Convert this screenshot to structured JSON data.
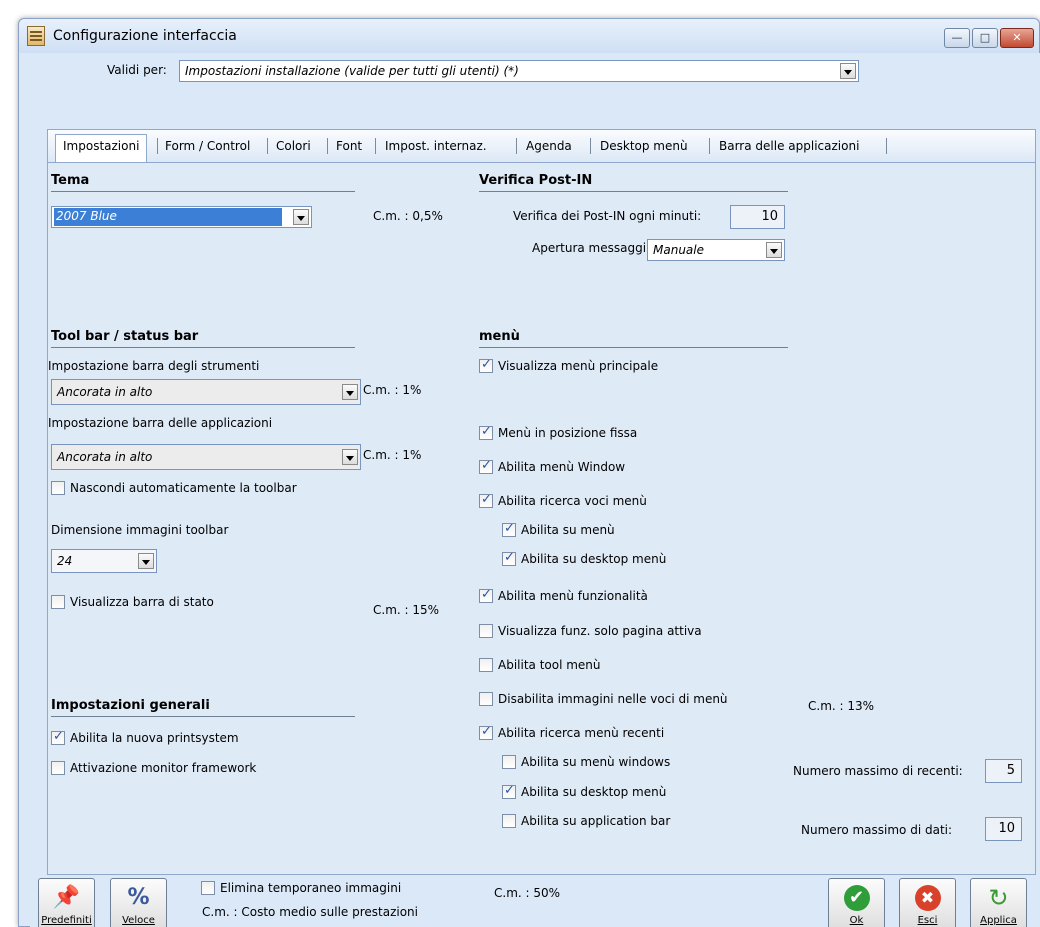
{
  "window": {
    "title": "Configurazione interfaccia"
  },
  "validi": {
    "label": "Validi per:",
    "value": "Impostazioni installazione (valide per tutti gli utenti) (*)"
  },
  "tabs": [
    "Impostazioni",
    "Form / Control",
    "Colori",
    "Font",
    "Impost. internaz.",
    "Agenda",
    "Desktop menù",
    "Barra delle applicazioni"
  ],
  "tema": {
    "header": "Tema",
    "value": "2007 Blue",
    "cm": "C.m. : 0,5%"
  },
  "postin": {
    "header": "Verifica Post-IN",
    "minuti_label": "Verifica dei Post-IN ogni minuti:",
    "minuti_value": "10",
    "apertura_label": "Apertura messaggi:",
    "apertura_value": "Manuale"
  },
  "toolbar": {
    "header": "Tool bar / status bar",
    "strumenti_label": "Impostazione barra degli strumenti",
    "strumenti_value": "Ancorata in alto",
    "strumenti_cm": "C.m. : 1%",
    "applicazioni_label": "Impostazione barra delle applicazioni",
    "applicazioni_value": "Ancorata in alto",
    "applicazioni_cm": "C.m. : 1%",
    "nascondi_label": "Nascondi automaticamente la toolbar",
    "dimensione_label": "Dimensione immagini toolbar",
    "dimensione_value": "24",
    "stato_label": "Visualizza barra di stato",
    "stato_cm": "C.m. : 15%"
  },
  "generali": {
    "header": "Impostazioni generali",
    "printsystem_label": "Abilita la nuova printsystem",
    "monitor_label": "Attivazione monitor framework"
  },
  "menu": {
    "header": "menù",
    "principale": "Visualizza menù principale",
    "fissa": "Menù in posizione fissa",
    "window": "Abilita menù Window",
    "ricerca": "Abilita ricerca voci menù",
    "su_menu": "Abilita su menù",
    "su_desktop": "Abilita su desktop menù",
    "funzionalita": "Abilita menù funzionalità",
    "funz_pagina": "Visualizza funz. solo pagina attiva",
    "tool": "Abilita tool menù",
    "disabilita_img": "Disabilita immagini nelle voci di menù",
    "disabilita_cm": "C.m. : 13%",
    "recenti": "Abilita ricerca menù recenti",
    "rec_windows": "Abilita su menù windows",
    "rec_desktop": "Abilita su desktop menù",
    "rec_appbar": "Abilita su application bar",
    "max_recenti_label": "Numero massimo di recenti:",
    "max_recenti_value": "5",
    "max_dati_label": "Numero massimo di dati:",
    "max_dati_value": "10"
  },
  "bottom": {
    "predefiniti": "Predefiniti",
    "veloce": "Veloce",
    "elimina_label": "Elimina temporaneo immagini",
    "elimina_cm": "C.m. : 50%",
    "legend": "C.m. : Costo medio sulle prestazioni",
    "ok": "Ok",
    "esci": "Esci",
    "applica": "Applica"
  }
}
